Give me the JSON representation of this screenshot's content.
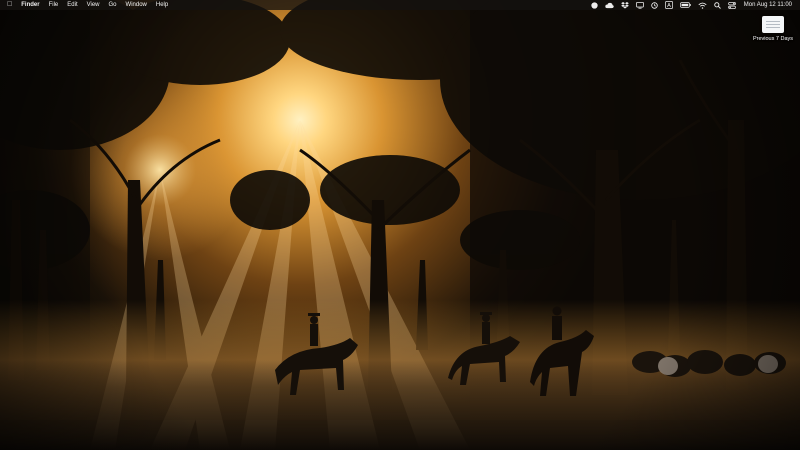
{
  "menubar": {
    "apple_icon": "apple-logo-icon",
    "app_name": "Finder",
    "menus": [
      "File",
      "Edit",
      "View",
      "Go",
      "Window",
      "Help"
    ],
    "status_icons": [
      "record-icon",
      "cloud-icon",
      "dropbox-icon",
      "display-icon",
      "timer-icon",
      "keyboard-input-icon",
      "battery-icon",
      "wifi-icon",
      "search-icon",
      "control-center-icon"
    ],
    "keyboard_letter": "A",
    "clock": "Mon Aug 12  11:00"
  },
  "desktop": {
    "file_label": "Previous 7 Days",
    "file_icon": "document-icon"
  },
  "wallpaper": {
    "description_icon": "wallpaper-image",
    "sun_color": "#ffd98a",
    "haze_color": "#c98a2e"
  }
}
